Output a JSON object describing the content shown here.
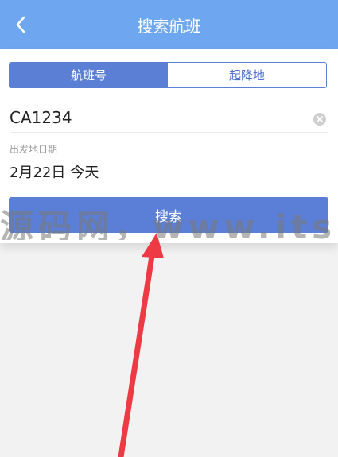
{
  "header": {
    "title": "搜索航班",
    "back_icon": "chevron-left-icon"
  },
  "tabs": [
    {
      "label": "航班号",
      "active": true
    },
    {
      "label": "起降地",
      "active": false
    }
  ],
  "flight_input": {
    "value": "CA1234",
    "clear_icon": "clear-circle-icon"
  },
  "date": {
    "label": "出发地日期",
    "value": "2月22日",
    "day": "今天"
  },
  "search_button": {
    "label": "搜索"
  },
  "watermark": {
    "text": "源码网，www.itsear.c"
  },
  "colors": {
    "header": "#6ea6ef",
    "accent": "#5c7fd6",
    "arrow": "#ee3a44"
  }
}
